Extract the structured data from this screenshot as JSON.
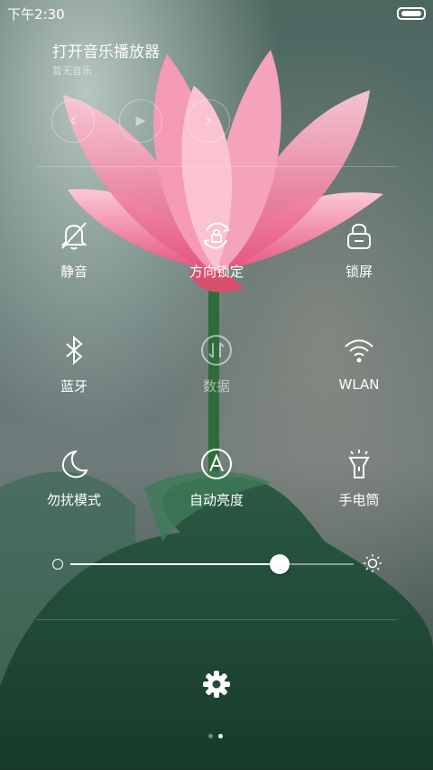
{
  "status_bar": {
    "time": "下午2:30"
  },
  "music": {
    "title": "打开音乐播放器",
    "subtitle": "暂无音乐"
  },
  "toggles": [
    {
      "label": "静音",
      "icon": "silent-bell-icon",
      "active": true
    },
    {
      "label": "方向锁定",
      "icon": "rotation-lock-icon",
      "active": true
    },
    {
      "label": "锁屏",
      "icon": "lock-icon",
      "active": true
    },
    {
      "label": "蓝牙",
      "icon": "bluetooth-icon",
      "active": true
    },
    {
      "label": "数据",
      "icon": "mobile-data-icon",
      "active": false
    },
    {
      "label": "WLAN",
      "icon": "wifi-icon",
      "active": true
    },
    {
      "label": "勿扰模式",
      "icon": "moon-icon",
      "active": true
    },
    {
      "label": "自动亮度",
      "icon": "auto-brightness-icon",
      "active": true
    },
    {
      "label": "手电筒",
      "icon": "flashlight-icon",
      "active": true
    }
  ],
  "brightness": {
    "level": 0.74
  },
  "pager": {
    "count": 2,
    "active_index": 1
  },
  "colors": {
    "accent": "#ffffff",
    "petal": "#f07aa0",
    "leaf": "#1f4a34"
  }
}
